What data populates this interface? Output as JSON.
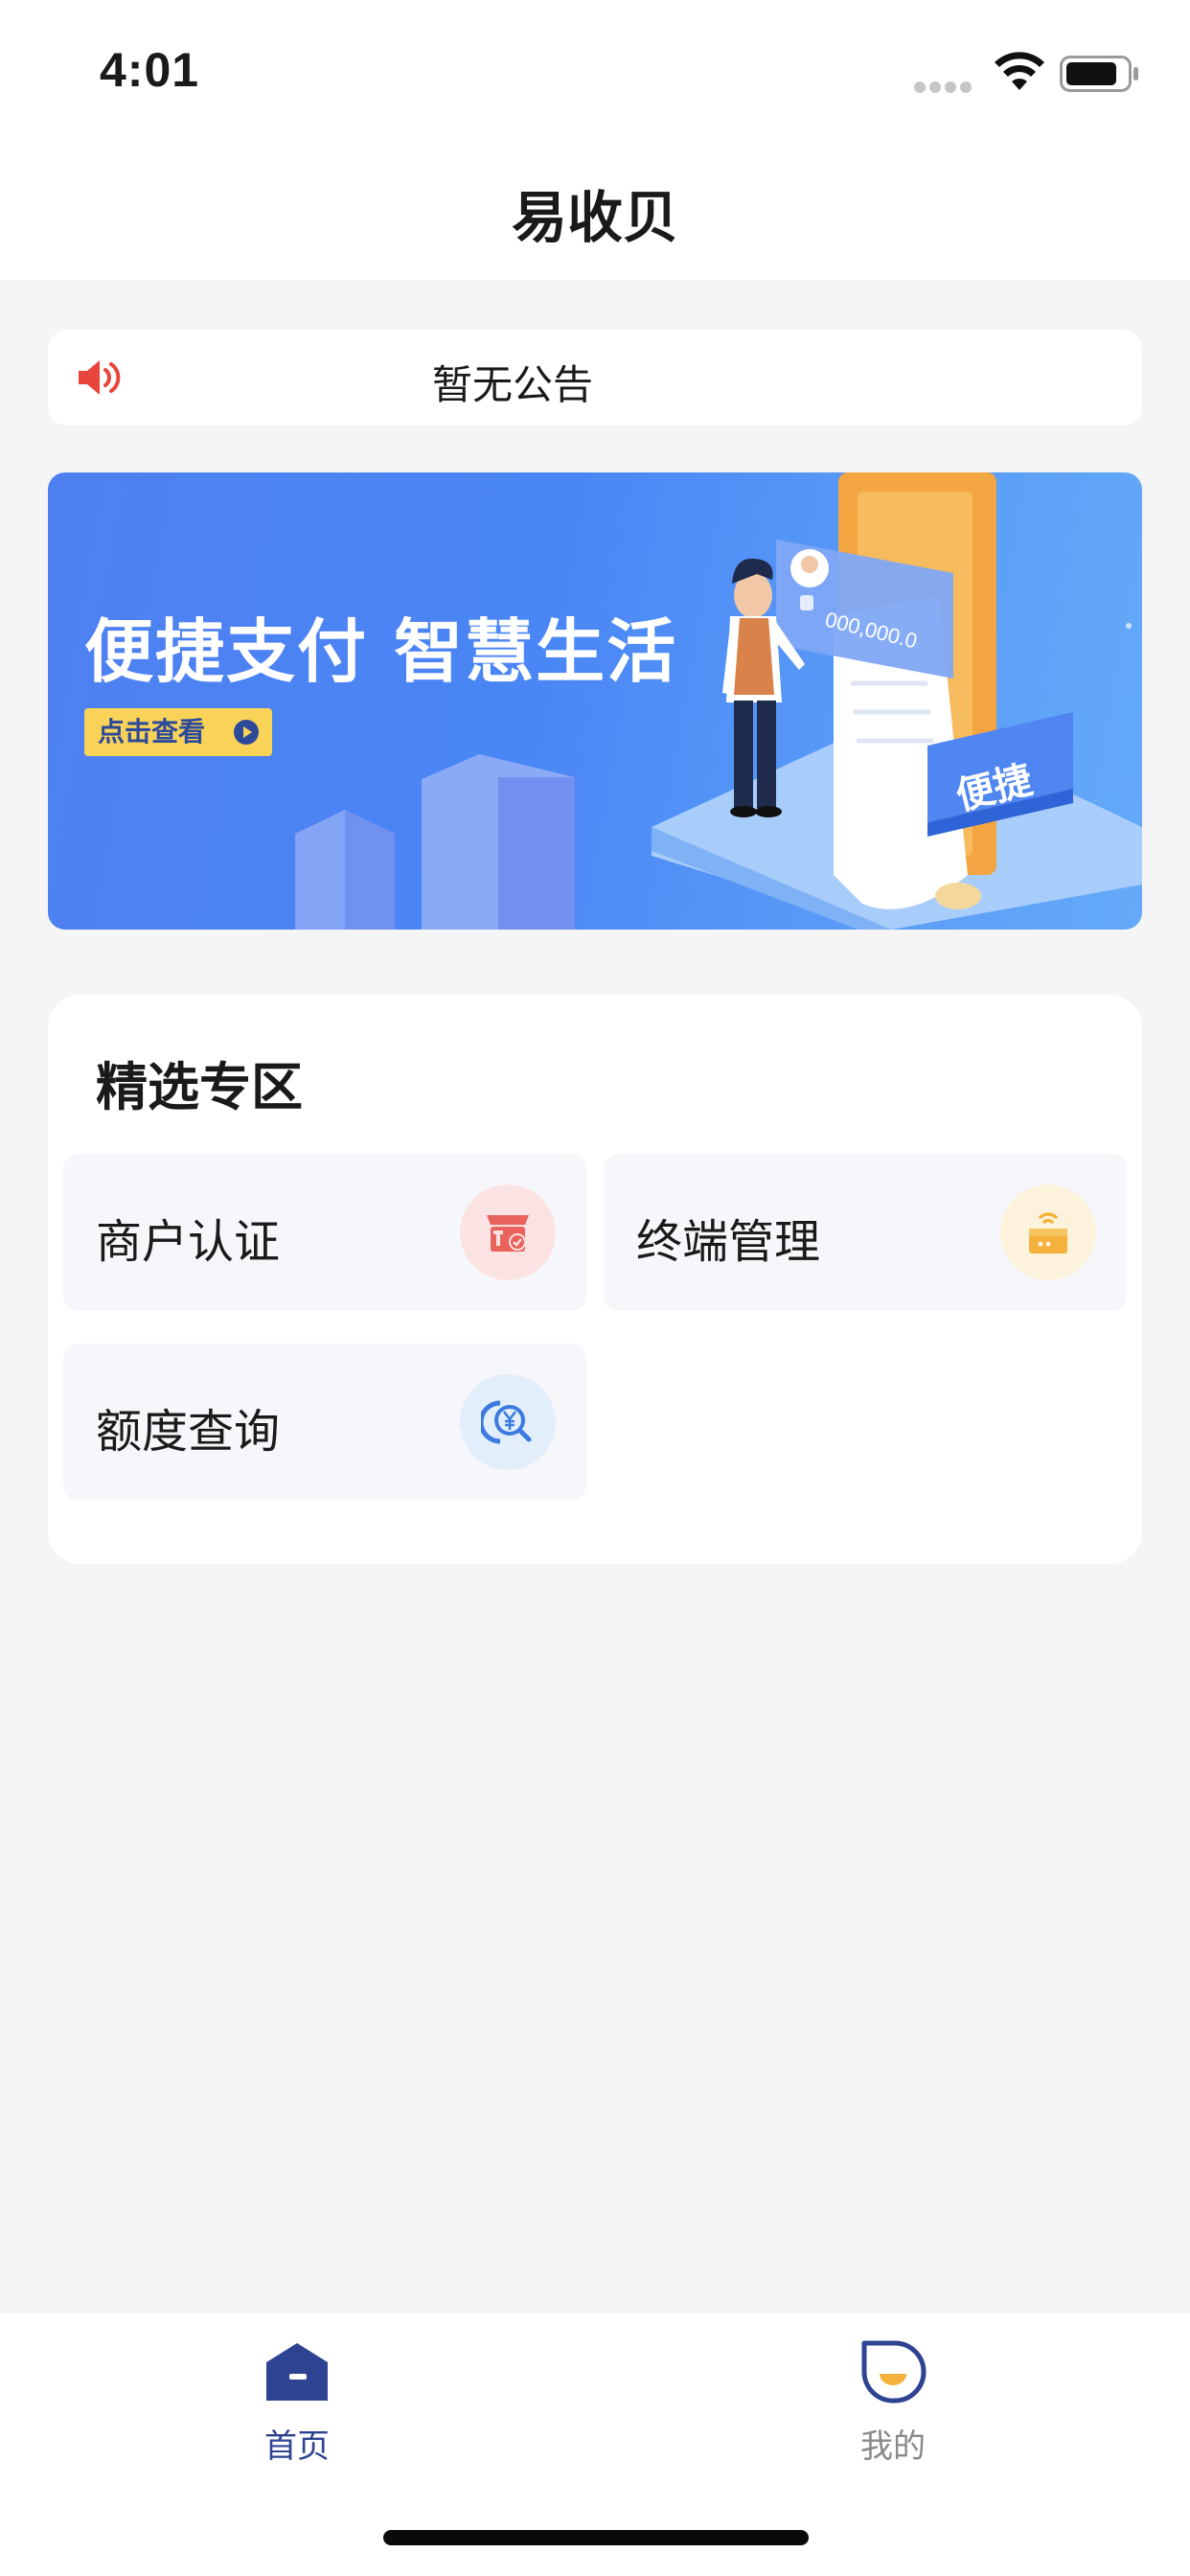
{
  "status_bar": {
    "time": "4:01"
  },
  "nav": {
    "title": "易收贝"
  },
  "notice": {
    "icon": "speaker-icon",
    "text": "暂无公告"
  },
  "banner": {
    "title": "便捷支付 智慧生活",
    "cta_label": "点击查看",
    "card_amount": "000,000.0",
    "badge_text": "便捷"
  },
  "section": {
    "title": "精选专区",
    "tiles": [
      {
        "label": "商户认证",
        "icon": "merchant-certification-icon",
        "icon_bg": "#fbe3e3",
        "icon_color": "#e9625b"
      },
      {
        "label": "终端管理",
        "icon": "terminal-management-icon",
        "icon_bg": "#fdf3dd",
        "icon_color": "#f4b23c"
      },
      {
        "label": "额度查询",
        "icon": "quota-search-icon",
        "icon_bg": "#e3eefb",
        "icon_color": "#3c7ae0"
      }
    ]
  },
  "tab_bar": {
    "tabs": [
      {
        "label": "首页",
        "icon": "home-icon",
        "active": true
      },
      {
        "label": "我的",
        "icon": "profile-icon",
        "active": false
      }
    ]
  },
  "colors": {
    "accent": "#2e4391",
    "inactive_tab": "#8a8a8e",
    "page_bg": "#f5f5f6",
    "banner_cta": "#f8d357"
  }
}
